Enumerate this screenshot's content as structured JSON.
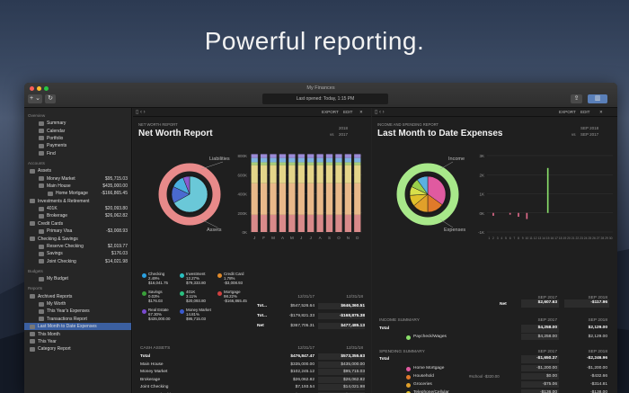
{
  "headline": "Powerful reporting.",
  "window": {
    "title": "My Finances",
    "last_opened": "Last opened: Today, 1:15 PM",
    "add_label": "+ ⌄",
    "sync_label": "↻"
  },
  "sidebar": {
    "overview_head": "Overview",
    "overview": [
      "Summary",
      "Calendar",
      "Portfolio",
      "Payments",
      "Find"
    ],
    "accounts_head": "Accounts",
    "accounts": [
      {
        "label": "Assets",
        "amount": "",
        "indent": 0
      },
      {
        "label": "Money Market",
        "amount": "$95,715.03",
        "indent": 1
      },
      {
        "label": "Main House",
        "amount": "$435,000.00",
        "indent": 1
      },
      {
        "label": "Home Mortgage",
        "amount": "-$166,865.45",
        "indent": 2
      },
      {
        "label": "Investments & Retirement",
        "amount": "",
        "indent": 0
      },
      {
        "label": "401K",
        "amount": "$20,093.80",
        "indent": 1
      },
      {
        "label": "Brokerage",
        "amount": "$26,062.82",
        "indent": 1
      },
      {
        "label": "Credit Cards",
        "amount": "",
        "indent": 0
      },
      {
        "label": "Primary Visa",
        "amount": "-$3,008.93",
        "indent": 1
      },
      {
        "label": "Checking & Savings",
        "amount": "",
        "indent": 0
      },
      {
        "label": "Reserve Checking",
        "amount": "$2,019.77",
        "indent": 1
      },
      {
        "label": "Savings",
        "amount": "$176.03",
        "indent": 1
      },
      {
        "label": "Joint Checking",
        "amount": "$14,021.98",
        "indent": 1
      }
    ],
    "budgets_head": "Budgets",
    "budgets": [
      "My Budget"
    ],
    "reports_head": "Reports",
    "reports": [
      {
        "label": "Archived Reports",
        "indent": 0,
        "selected": false
      },
      {
        "label": "My Worth",
        "indent": 1,
        "selected": false
      },
      {
        "label": "This Year's Expenses",
        "indent": 1,
        "selected": false
      },
      {
        "label": "Transactions Report",
        "indent": 1,
        "selected": false
      },
      {
        "label": "Last Month to Date Expenses",
        "indent": 0,
        "selected": true
      },
      {
        "label": "This Month",
        "indent": 0,
        "selected": false
      },
      {
        "label": "This Year",
        "indent": 0,
        "selected": false
      },
      {
        "label": "Category Report",
        "indent": 0,
        "selected": false
      }
    ]
  },
  "net_worth": {
    "export_label": "EXPORT",
    "edit_label": "EDIT",
    "label": "NET WORTH REPORT",
    "title": "Net Worth Report",
    "year_a": "2018",
    "vs": "vs",
    "year_b": "2017",
    "pie_label_top": "Liabilities",
    "pie_label_bottom": "Assets",
    "y_ticks": [
      "800K",
      "600K",
      "400K",
      "200K",
      "0K"
    ],
    "months": [
      "J",
      "F",
      "M",
      "A",
      "M",
      "J",
      "J",
      "A",
      "S",
      "O",
      "N",
      "D"
    ],
    "bar_colors": [
      "#d98a8a",
      "#e9b98a",
      "#e4d58a",
      "#a7cd7a",
      "#7fb2e0",
      "#9b8ad6"
    ],
    "bar_values": [
      [
        180,
        330,
        190,
        30,
        45,
        40
      ],
      [
        180,
        330,
        190,
        30,
        45,
        40
      ],
      [
        180,
        330,
        190,
        30,
        45,
        40
      ],
      [
        180,
        330,
        190,
        30,
        45,
        40
      ],
      [
        180,
        330,
        190,
        30,
        45,
        40
      ],
      [
        180,
        330,
        190,
        30,
        45,
        40
      ],
      [
        180,
        330,
        190,
        30,
        45,
        40
      ],
      [
        180,
        330,
        190,
        30,
        45,
        40
      ],
      [
        180,
        330,
        190,
        30,
        45,
        40
      ],
      [
        180,
        330,
        190,
        30,
        45,
        40
      ],
      [
        180,
        330,
        190,
        30,
        45,
        40
      ],
      [
        180,
        330,
        190,
        30,
        45,
        40
      ]
    ],
    "legend": [
      {
        "name": "Checking",
        "pct": "2.49%",
        "amt": "$16,041.75",
        "color": "#2aa0e0"
      },
      {
        "name": "Investment",
        "pct": "12.27%",
        "amt": "$79,333.80",
        "color": "#2ac0c0"
      },
      {
        "name": "Credit Card",
        "pct": "1.78%",
        "amt": "-$3,008.93",
        "color": "#e08a2a"
      },
      {
        "name": "Savings",
        "pct": "0.03%",
        "amt": "$176.03",
        "color": "#3aa03a"
      },
      {
        "name": "401K",
        "pct": "3.11%",
        "amt": "$20,093.80",
        "color": "#2ac080"
      },
      {
        "name": "Mortgage",
        "pct": "98.22%",
        "amt": "-$166,865.45",
        "color": "#d04040"
      },
      {
        "name": "Real Estate",
        "pct": "67.30%",
        "amt": "$435,000.00",
        "color": "#7a4ad0"
      },
      {
        "name": "Money Market",
        "pct": "14.81%",
        "amt": "$95,715.03",
        "color": "#3a5ad0"
      }
    ],
    "summary_col_a": "12/31/17",
    "summary_col_b": "12/31/18",
    "summary": [
      {
        "label": "Tot...",
        "a": "$547,526.64",
        "b": "$646,360.51"
      },
      {
        "label": "Tot...",
        "a": "-$179,821.33",
        "b": "-$168,875.38"
      },
      {
        "label": "Net",
        "a": "$367,705.31",
        "b": "$477,485.13"
      }
    ],
    "cash_head": "CASH ASSETS",
    "cash_col_a": "12/31/17",
    "cash_col_b": "12/31/18",
    "cash_rows": [
      {
        "label": "Total",
        "a": "$476,847.47",
        "b": "$573,355.63",
        "bold": true
      },
      {
        "label": "Main House",
        "a": "$335,000.00",
        "b": "$435,000.00",
        "bold": false
      },
      {
        "label": "Money Market",
        "a": "$102,245.12",
        "b": "$95,715.03",
        "bold": false
      },
      {
        "label": "Brokerage",
        "a": "$26,062.82",
        "b": "$26,062.82",
        "bold": false
      },
      {
        "label": "Joint Checking",
        "a": "$7,193.54",
        "b": "$14,021.98",
        "bold": false
      },
      {
        "label": "Reserve Checking",
        "a": "$2,019.77",
        "b": "$2,019.77",
        "bold": false
      }
    ]
  },
  "expenses": {
    "export_label": "EXPORT",
    "edit_label": "EDIT",
    "label": "INCOME AND SPENDING REPORT",
    "title": "Last Month to Date Expenses",
    "period_a": "SEP 2018",
    "vs": "vs",
    "period_b": "SEP 2017",
    "pie_label_top": "Income",
    "pie_label_bottom": "Expenses",
    "y_ticks": [
      "3K",
      "2K",
      "1K",
      "0K",
      "-1K"
    ],
    "days": [
      "1",
      "2",
      "3",
      "4",
      "5",
      "6",
      "7",
      "8",
      "9",
      "10",
      "11",
      "12",
      "13",
      "14",
      "15",
      "16",
      "17",
      "18",
      "19",
      "20",
      "21",
      "22",
      "23",
      "24",
      "25",
      "26",
      "27",
      "28",
      "29",
      "30"
    ],
    "daily_values": [
      0,
      -150,
      0,
      0,
      0,
      -90,
      0,
      -200,
      0,
      -320,
      0,
      0,
      0,
      0,
      2350,
      0,
      0,
      0,
      0,
      0,
      0,
      0,
      0,
      0,
      0,
      0,
      0,
      0,
      0,
      0
    ],
    "net_col_a": "SEP 2017",
    "net_col_b": "SEP 2018",
    "net_label": "Net",
    "net_a": "$2,607.63",
    "net_b": "-$117.96",
    "income_head": "INCOME SUMMARY",
    "income_col_a": "SEP 2017",
    "income_col_b": "SEP 2018",
    "income_total_label": "Total",
    "income_total_a": "$4,258.00",
    "income_total_b": "$2,129.00",
    "income_rows": [
      {
        "label": "Paycheck/Wages",
        "a": "$4,258.00",
        "b": "$2,129.00",
        "color": "#8adf6a"
      }
    ],
    "spending_head": "SPENDING SUMMARY",
    "spending_col_a": "SEP 2017",
    "spending_col_b": "SEP 2018",
    "spending_total_label": "Total",
    "spending_total_a": "-$1,650.37",
    "spending_total_b": "-$2,246.96",
    "spending_tag": "#school -$320.00",
    "spending_rows": [
      {
        "label": "Home Mortgage",
        "a": "-$1,200.00",
        "b": "-$1,200.00",
        "color": "#e05aa0"
      },
      {
        "label": "Household",
        "a": "$0.00",
        "b": "-$432.66",
        "color": "#e07a2a"
      },
      {
        "label": "Groceries",
        "a": "-$75.06",
        "b": "-$314.81",
        "color": "#e0a02a"
      },
      {
        "label": "Telephone/Cellular",
        "a": "-$136.00",
        "b": "-$138.00",
        "color": "#e0c02a"
      },
      {
        "label": "Dining/Restaurants",
        "a": "-$175.58",
        "b": "-$95.22",
        "color": "#e0d84a"
      },
      {
        "label": "Gasoline/Fuel",
        "a": "-$33.00",
        "b": "-$29.50",
        "color": "#d8e04a"
      }
    ]
  }
}
